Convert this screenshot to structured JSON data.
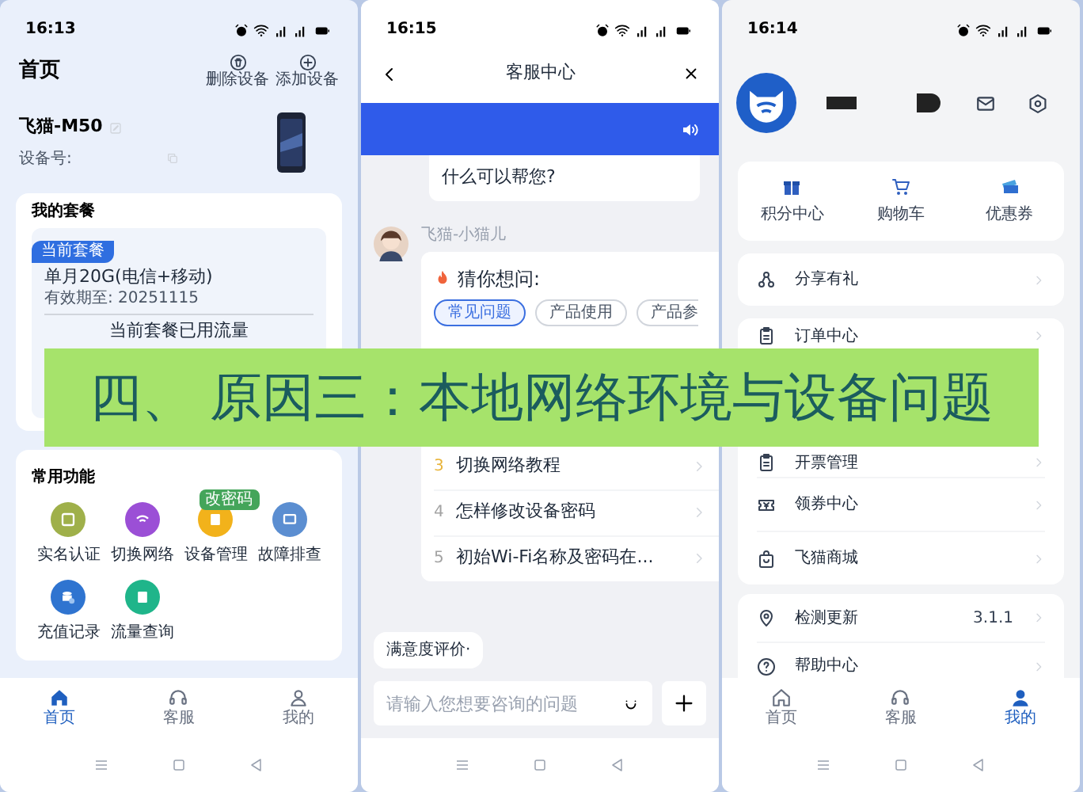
{
  "home_screen": {
    "status_time": "16:13",
    "title": "首页",
    "actions": [
      "删除设备",
      "添加设备"
    ],
    "device": {
      "name": "飞猫-M50",
      "id_label": "设备号:"
    },
    "plan": {
      "heading": "我的套餐",
      "badge": "当前套餐",
      "name": "单月20G(电信+移动)",
      "expiry": "有效期至: 20251115",
      "usage_title": "当前套餐已用流量"
    },
    "functions": {
      "heading": "常用功能",
      "items": [
        {
          "label": "实名认证",
          "color": "#9fb04a"
        },
        {
          "label": "切换网络",
          "color": "#9b4fd6"
        },
        {
          "label": "设备管理",
          "color": "#f2b21b",
          "badge": "改密码"
        },
        {
          "label": "故障排查",
          "color": "#5b8ed1"
        },
        {
          "label": "充值记录",
          "color": "#2f74d0"
        },
        {
          "label": "流量查询",
          "color": "#1fb58a"
        }
      ]
    },
    "nav": [
      {
        "label": "首页",
        "selected": true
      },
      {
        "label": "客服",
        "selected": false
      },
      {
        "label": "我的",
        "selected": false
      }
    ]
  },
  "support_screen": {
    "status_time": "16:15",
    "title": "客服中心",
    "greeting_tail": "什么可以帮您?",
    "agent_name": "飞猫-小猫儿",
    "suggest_title": "猜你想问:",
    "chips": [
      {
        "label": "常见问题",
        "selected": true
      },
      {
        "label": "产品使用",
        "selected": false
      },
      {
        "label": "产品参",
        "selected": false
      }
    ],
    "questions": [
      {
        "number": "3",
        "text": "切换网络教程",
        "color": "#e8b43a"
      },
      {
        "number": "4",
        "text": "怎样修改设备密码",
        "color": "#a3a3a3"
      },
      {
        "number": "5",
        "text": "初始Wi-Fi名称及密码在...",
        "color": "#a3a3a3"
      }
    ],
    "rating": "满意度评价·",
    "input_placeholder": "请输入您想要咨询的问题"
  },
  "profile_screen": {
    "status_time": "16:14",
    "shortcuts": [
      "积分中心",
      "购物车",
      "优惠券"
    ],
    "groups": [
      [
        {
          "label": "分享有礼"
        }
      ],
      [
        {
          "label": "订单中心"
        },
        {
          "label": "开票管理"
        },
        {
          "label": "领券中心"
        },
        {
          "label": "飞猫商城"
        }
      ],
      [
        {
          "label": "检测更新",
          "value": "3.1.1"
        },
        {
          "label": "帮助中心"
        }
      ]
    ],
    "nav": [
      {
        "label": "首页",
        "selected": false
      },
      {
        "label": "客服",
        "selected": false
      },
      {
        "label": "我的",
        "selected": true
      }
    ]
  },
  "banner": {
    "text": "四、 原因三：本地网络环境与设备问题"
  }
}
